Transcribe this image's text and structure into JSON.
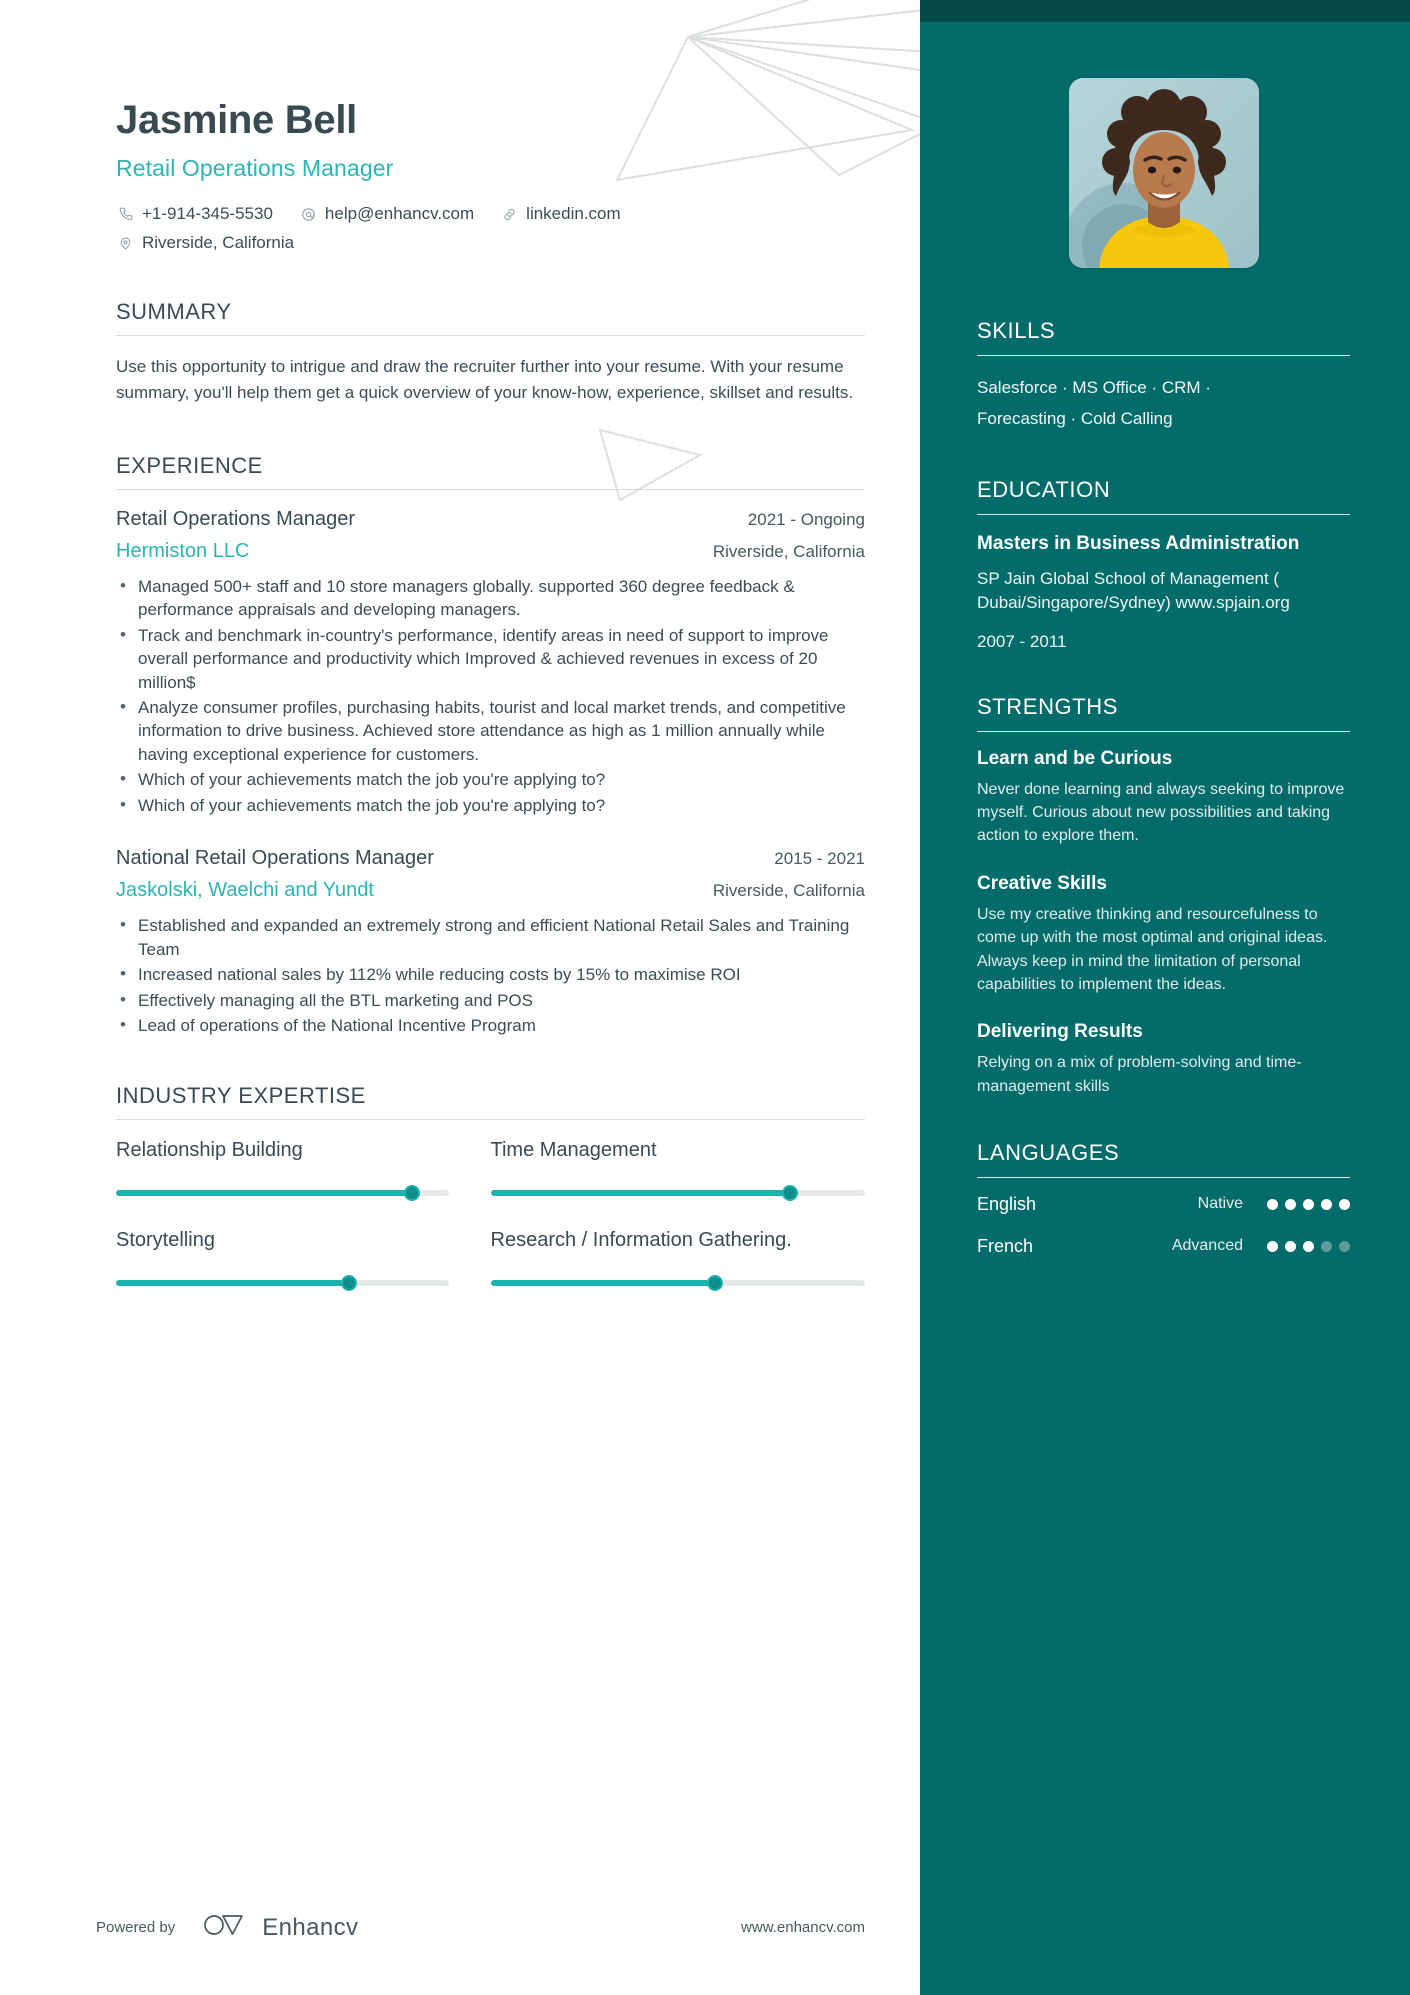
{
  "header": {
    "name": "Jasmine Bell",
    "role": "Retail Operations Manager",
    "contacts": [
      {
        "icon": "phone-icon",
        "value": "+1-914-345-5530"
      },
      {
        "icon": "email-icon",
        "value": "help@enhancv.com"
      },
      {
        "icon": "link-icon",
        "value": "linkedin.com"
      },
      {
        "icon": "location-icon",
        "value": "Riverside, California"
      }
    ]
  },
  "summary": {
    "heading": "SUMMARY",
    "text": "Use this opportunity to intrigue and draw the recruiter further into your resume. With your resume summary, you'll help them get a quick overview of your know-how, experience, skillset and results."
  },
  "experience": {
    "heading": "EXPERIENCE",
    "jobs": [
      {
        "title": "Retail Operations Manager",
        "date": "2021 - Ongoing",
        "company": "Hermiston LLC",
        "location": "Riverside, California",
        "bullets": [
          "Managed  500+ staff and 10 store managers globally. supported 360 degree feedback & performance appraisals and developing managers.",
          " Track and benchmark in-country's performance, identify areas in need of support to improve overall performance and productivity which Improved & achieved revenues in excess of 20 million$",
          "Analyze consumer profiles, purchasing habits, tourist and local market trends, and competitive information to drive business. Achieved store attendance as high as 1 million annually while having exceptional experience for customers.",
          "Which of your achievements match the job you're applying to?",
          "Which of your achievements match the job you're applying to?"
        ]
      },
      {
        "title": "National Retail Operations Manager",
        "date": "2015 - 2021",
        "company": "Jaskolski, Waelchi and Yundt",
        "location": "Riverside, California",
        "bullets": [
          "Established and expanded an extremely strong and efficient National Retail Sales and Training Team",
          "Increased national sales by 112% while reducing costs by 15% to maximise ROI",
          "Effectively managing all the BTL marketing and POS",
          "Lead of operations of the National Incentive Program"
        ]
      }
    ]
  },
  "industry_expertise": {
    "heading": "INDUSTRY EXPERTISE",
    "items": [
      {
        "label": "Relationship Building",
        "value": 89
      },
      {
        "label": "Time Management",
        "value": 80
      },
      {
        "label": "Storytelling",
        "value": 70
      },
      {
        "label": "Research / Information Gathering.",
        "value": 60
      }
    ]
  },
  "sidebar": {
    "skills": {
      "heading": "SKILLS",
      "lines": [
        "Salesforce · MS Office · CRM ·",
        "Forecasting · Cold Calling"
      ]
    },
    "education": {
      "heading": "EDUCATION",
      "degree": "Masters in Business Administration",
      "school": "SP Jain Global School of Management ( Dubai/Singapore/Sydney) www.spjain.org",
      "date": "2007 - 2011"
    },
    "strengths": {
      "heading": "STRENGTHS",
      "items": [
        {
          "title": "Learn and be Curious",
          "desc": "Never done learning and always seeking to improve myself. Curious about new possibilities and taking action to explore them."
        },
        {
          "title": "Creative Skills",
          "desc": "Use my creative thinking and resourcefulness to come up with the most optimal and original ideas. Always keep in mind the limitation of personal capabilities to implement the ideas."
        },
        {
          "title": "Delivering Results",
          "desc": "Relying on a mix of problem-solving and time-management skills"
        }
      ]
    },
    "languages": {
      "heading": "LANGUAGES",
      "items": [
        {
          "name": "English",
          "level": "Native",
          "filled": 5,
          "total": 5
        },
        {
          "name": "French",
          "level": "Advanced",
          "filled": 3,
          "total": 5
        }
      ]
    }
  },
  "footer": {
    "powered_by": "Powered by",
    "brand": "Enhancv",
    "url": "www.enhancv.com"
  },
  "colors": {
    "accent_teal": "#2ab5b5",
    "sidebar_bg": "#046b6b",
    "sidebar_topbar": "#044a49",
    "bar_fill": "#1bb3ae",
    "bar_knob": "#0f8f8c",
    "heading_text": "#394a51"
  }
}
